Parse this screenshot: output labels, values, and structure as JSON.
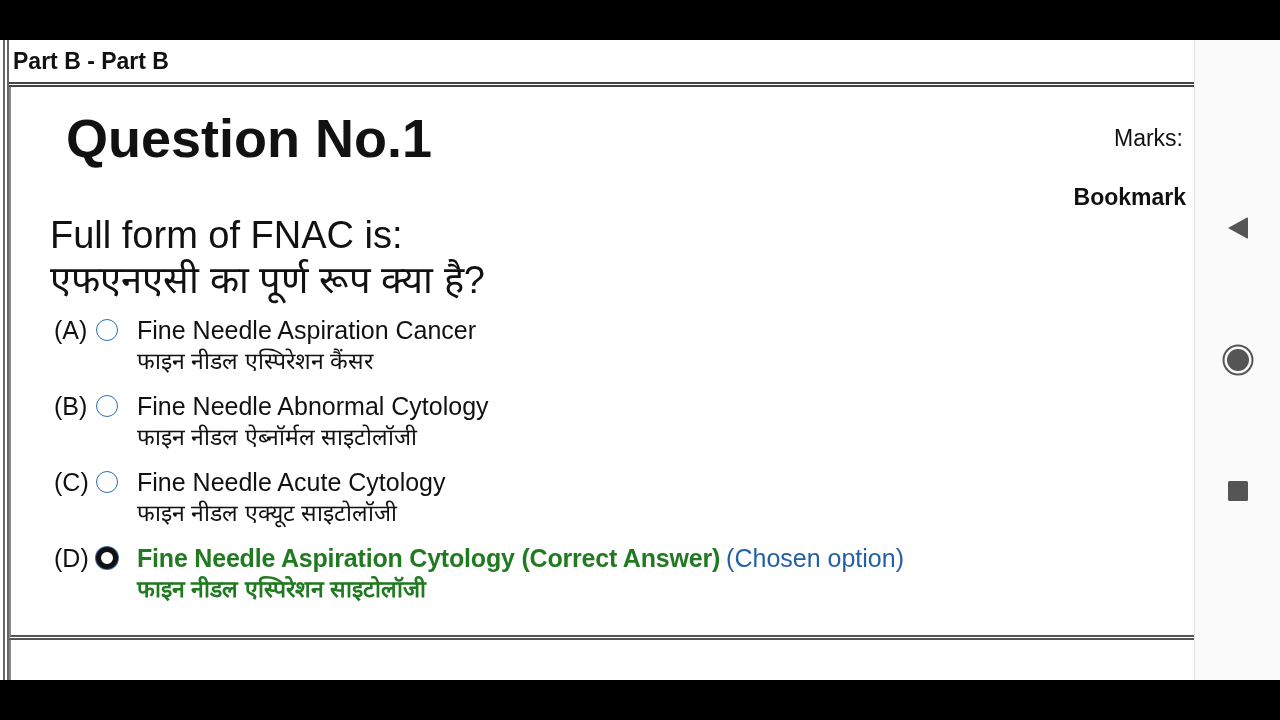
{
  "header": {
    "title": "Part B - Part B"
  },
  "question": {
    "heading": "Question No.1",
    "marks": "Marks:",
    "bookmark": "Bookmark",
    "text_en": "Full form of FNAC is:",
    "text_hi": "एफएनएसी का पूर्ण रूप क्या है?",
    "options": [
      {
        "label": "(A)",
        "text_en": "Fine Needle Aspiration Cancer",
        "text_hi": "फाइन नीडल एस्पिरेशन कैंसर",
        "selected": false,
        "correct": false
      },
      {
        "label": "(B)",
        "text_en": "Fine Needle Abnormal Cytology",
        "text_hi": "फाइन नीडल ऐब्नॉर्मल साइटोलॉजी",
        "selected": false,
        "correct": false
      },
      {
        "label": "(C)",
        "text_en": "Fine Needle Acute Cytology",
        "text_hi": "फाइन नीडल एक्यूट साइटोलॉजी",
        "selected": false,
        "correct": false
      },
      {
        "label": "(D)",
        "text_en": "Fine Needle Aspiration Cytology",
        "correct_note": "(Correct Answer)",
        "chosen_note": "(Chosen option)",
        "text_hi": "फाइन नीडल एस्पिरेशन साइटोलॉजी",
        "selected": true,
        "correct": true
      }
    ]
  }
}
